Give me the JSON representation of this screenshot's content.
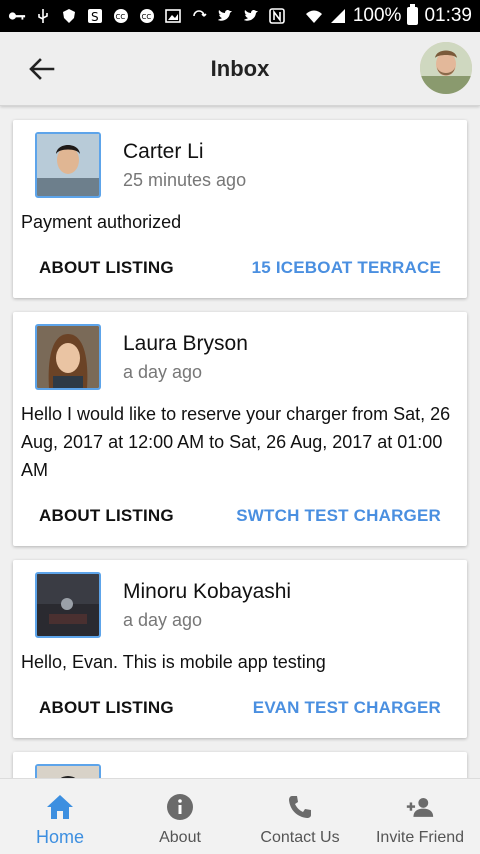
{
  "status_bar": {
    "battery": "100%",
    "time": "01:39",
    "icons": [
      "key-icon",
      "usb-icon",
      "shield-icon",
      "s-icon",
      "cc-icon",
      "cc-icon",
      "image-icon",
      "sync-icon",
      "twitter-icon",
      "twitter-icon",
      "nfc-icon",
      "wifi-icon",
      "signal-icon",
      "battery-icon"
    ]
  },
  "header": {
    "title": "Inbox",
    "back_icon": "arrow-left-icon"
  },
  "messages": [
    {
      "name": "Carter Li",
      "time": "25 minutes ago",
      "text": "Payment authorized",
      "about_label": "ABOUT LISTING",
      "listing_label": "15 ICEBOAT TERRACE"
    },
    {
      "name": "Laura Bryson",
      "time": "a day ago",
      "text": "Hello I would like to reserve your charger from Sat, 26 Aug, 2017 at 12:00 AM to Sat, 26 Aug, 2017 at 01:00 AM",
      "about_label": "ABOUT LISTING",
      "listing_label": "SWTCH TEST CHARGER"
    },
    {
      "name": "Minoru Kobayashi",
      "time": "a day ago",
      "text": "Hello, Evan. This is mobile app testing",
      "about_label": "ABOUT LISTING",
      "listing_label": "EVAN TEST CHARGER"
    }
  ],
  "bottom_nav": [
    {
      "label": "Home",
      "icon": "home-icon",
      "active": true
    },
    {
      "label": "About",
      "icon": "info-icon",
      "active": false
    },
    {
      "label": "Contact Us",
      "icon": "phone-icon",
      "active": false
    },
    {
      "label": "Invite Friend",
      "icon": "add-person-icon",
      "active": false
    }
  ],
  "colors": {
    "accent": "#4a8fe0",
    "active_nav": "#3d8fe0",
    "avatar_border": "#5da4ea"
  }
}
